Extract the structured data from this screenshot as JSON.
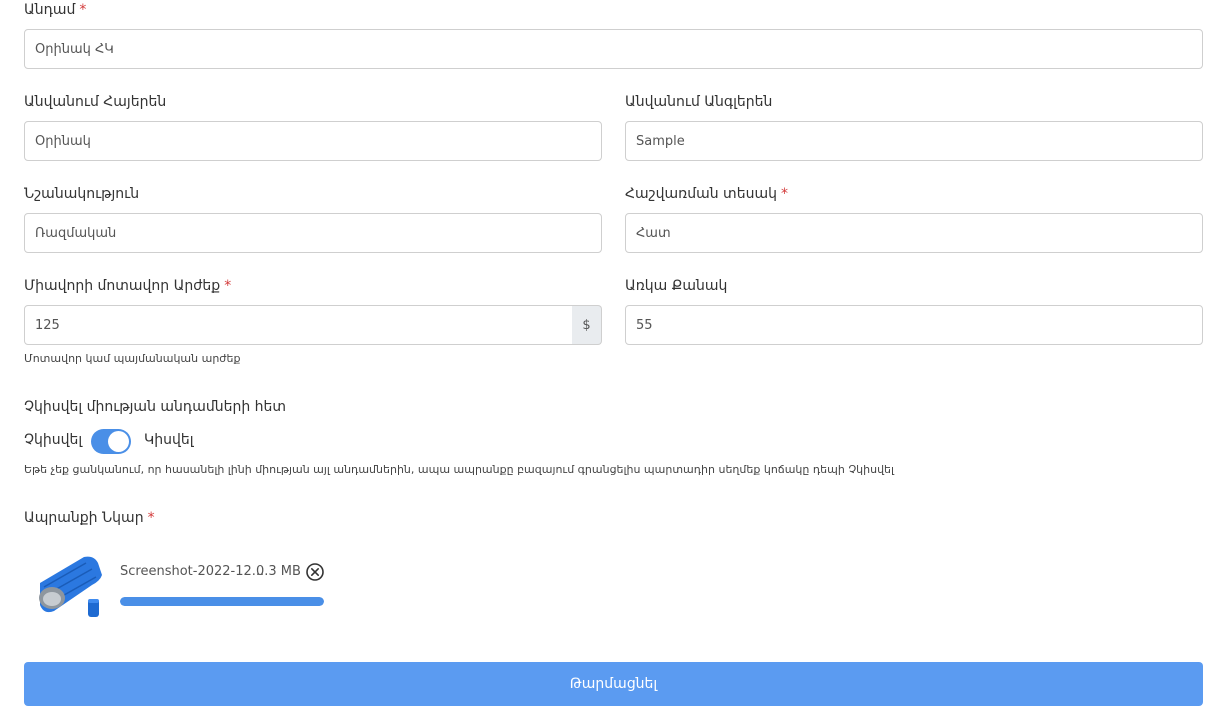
{
  "form": {
    "member": {
      "label": "Անդամ",
      "required_mark": "*",
      "value": "Օրինակ ՀԿ"
    },
    "name_am": {
      "label": "Անվանում Հայերեն",
      "value": "Օրինակ"
    },
    "name_en": {
      "label": "Անվանում Անգլերեն",
      "value": "Sample"
    },
    "purpose": {
      "label": "Նշանակություն",
      "value": "Ռազմական"
    },
    "unit_type": {
      "label": "Հաշվառման տեսակ",
      "required_mark": "*",
      "value": "Հատ"
    },
    "unit_value": {
      "label": "Միավորի մոտավոր Արժեք",
      "required_mark": "*",
      "value": "125",
      "currency": "$",
      "help": "Մոտավոր կամ պայմանական արժեք"
    },
    "quantity": {
      "label": "Առկա Քանակ",
      "value": "55"
    },
    "share": {
      "label": "Չկիսվել միության անդամների հետ",
      "off_label": "Չկիսվել",
      "on_label": "Կիսվել",
      "enabled": true,
      "help": "Եթե չեք ցանկանում, որ հասանելի լինի միության այլ անդամներին, ապա ապրանքը բազայում գրանցելիս պարտադիր սեղմեք կոճակը դեպի Չկիսվել"
    },
    "image": {
      "label": "Ապրանքի Նկար",
      "required_mark": "*",
      "file_name": "Screenshot-2022-12...",
      "file_size": "0.3 MB",
      "upload_progress": 1.0
    },
    "submit_label": "Թարմացնել"
  },
  "colors": {
    "accent": "#4a8fe7",
    "submit": "#5b9bf1",
    "required": "#d33a3a"
  },
  "icons": {
    "remove": "close-circle-icon",
    "thumbnail": "sleeping-bag-image"
  }
}
